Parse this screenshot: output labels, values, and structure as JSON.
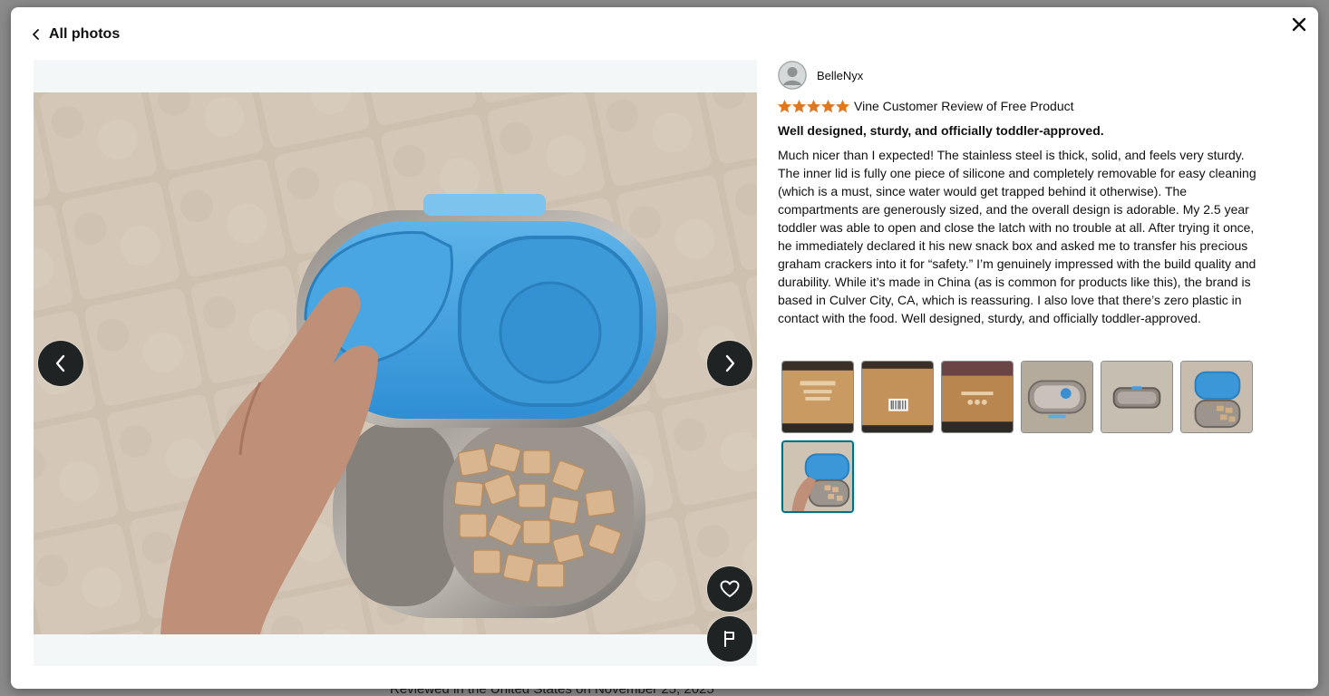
{
  "modal": {
    "back_label": "All photos",
    "close_icon": "close-icon"
  },
  "viewer": {
    "prev_icon": "chevron-left-icon",
    "next_icon": "chevron-right-icon",
    "like_icon": "heart-icon",
    "report_icon": "flag-icon",
    "photo_subject": "lunch-box-photo"
  },
  "review": {
    "reviewer_name": "BelleNyx",
    "rating": 5,
    "rating_max": 5,
    "star_color": "#de7921",
    "vine_label": "Vine Customer Review of Free Product",
    "headline": "Well designed, sturdy, and officially toddler-approved.",
    "body": "Much nicer than I expected! The stainless steel is thick, solid, and feels very sturdy. The inner lid is fully one piece of silicone and completely removable for easy cleaning (which is a must, since water would get trapped behind it otherwise). The compartments are generously sized, and the overall design is adorable. My 2.5 year toddler was able to open and close the latch with no trouble at all. After trying it once, he immediately declared it his new snack box and asked me to transfer his precious graham crackers into it for “safety.” I’m genuinely impressed with the build quality and durability. While it’s made in China (as is common for products like this), the brand is based in Culver City, CA, which is reassuring. I also love that there’s zero plastic in contact with the food. Well designed, sturdy, and officially toddler-approved."
  },
  "thumbnails": {
    "count": 7,
    "selected_index": 7,
    "accent_color": "#007185"
  },
  "background_page": {
    "footer_text": "Reviewed in the United States on November 25, 2025"
  }
}
